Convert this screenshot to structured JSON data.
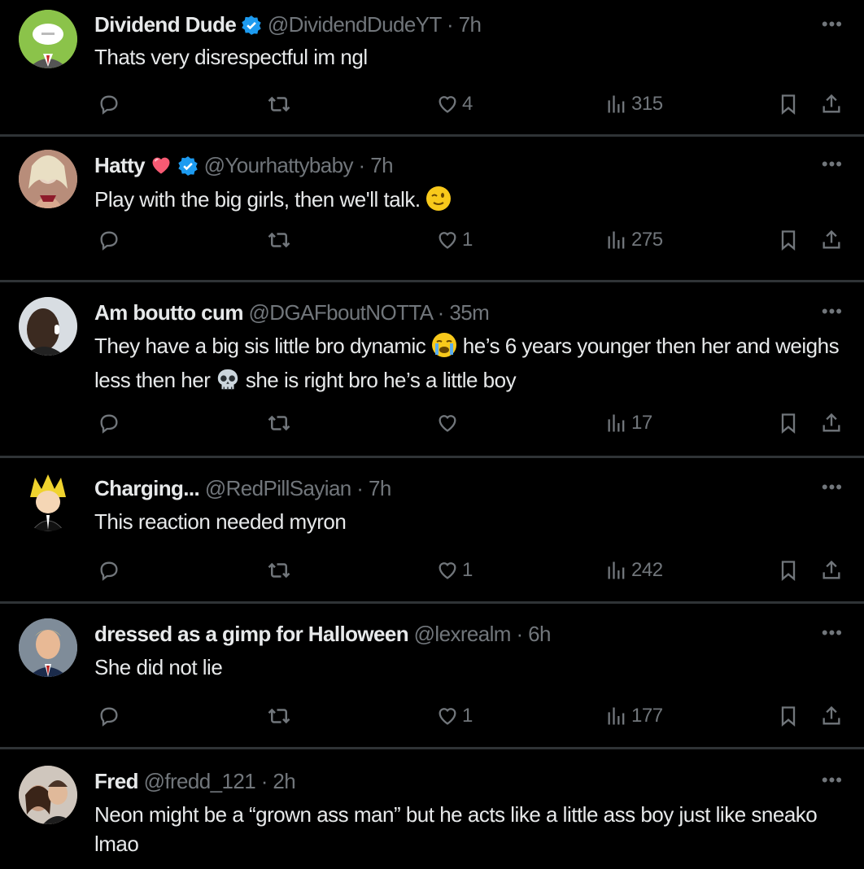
{
  "tweets": [
    {
      "name": "Dividend Dude",
      "handle": "@DividendDudeYT · 7h",
      "verified": true,
      "heart": false,
      "text": "Thats very disrespectful im ngl",
      "likes": "4",
      "views": "315",
      "avatar_color": "#8bc34a"
    },
    {
      "name": "Hatty",
      "handle": "@Yourhattybaby · 7h",
      "verified": true,
      "heart": true,
      "text": "Play with the big girls, then we'll talk.",
      "emoji": "winking-face-emoji",
      "likes": "1",
      "views": "275",
      "avatar_color": "#c49a8a"
    },
    {
      "name": "Am boutto cum",
      "handle": "@DGAFboutNOTTA · 35m",
      "verified": false,
      "heart": false,
      "text_parts": [
        "They have a big sis little bro dynamic",
        "he’s 6 years younger then her and weighs less then her",
        "she is right bro he’s a little boy"
      ],
      "likes": "",
      "views": "17",
      "avatar_color": "#5a4a3f"
    },
    {
      "name": "Charging...",
      "handle": "@RedPillSayian · 7h",
      "verified": false,
      "heart": false,
      "text": "This reaction needed myron",
      "likes": "1",
      "views": "242",
      "avatar_color": "#000000"
    },
    {
      "name": "dressed as a gimp for Halloween",
      "handle": "@lexrealm · 6h",
      "verified": false,
      "heart": false,
      "text": "She did not lie",
      "likes": "1",
      "views": "177",
      "avatar_color": "#9aa5b1"
    },
    {
      "name": "Fred",
      "handle": "@fredd_121 · 2h",
      "verified": false,
      "heart": false,
      "text": "Neon might be a “grown ass man” but he acts like a little ass boy just like sneako lmao",
      "avatar_color": "#7a6a5e"
    }
  ],
  "colors": {
    "background": "#000000",
    "text": "#e7e9ea",
    "muted": "#71767b",
    "divider": "#2f3336",
    "verified": "#1d9bf0"
  },
  "icons": [
    "reply-icon",
    "retweet-icon",
    "like-icon",
    "views-icon",
    "bookmark-icon",
    "share-icon",
    "more-icon",
    "verified-badge-icon"
  ]
}
